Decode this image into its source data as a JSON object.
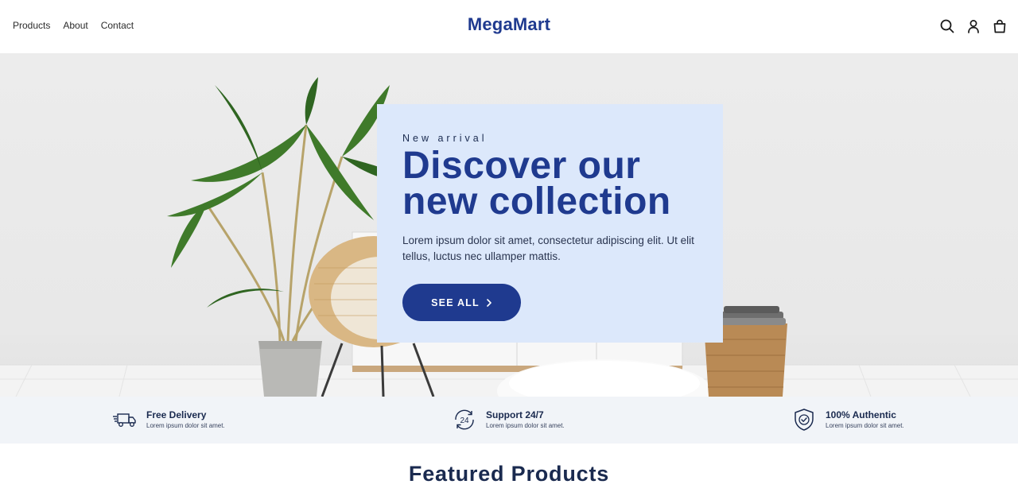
{
  "header": {
    "nav": [
      {
        "label": "Products"
      },
      {
        "label": "About"
      },
      {
        "label": "Contact"
      }
    ],
    "logo": "MegaMart",
    "icons": [
      "search-icon",
      "user-icon",
      "shopping-bag-icon"
    ]
  },
  "hero": {
    "eyebrow": "New arrival",
    "title_line1": "Discover our",
    "title_line2": "new collection",
    "description": "Lorem ipsum dolor sit amet, consectetur adipiscing elit. Ut elit tellus, luctus nec ullamper mattis.",
    "button_label": "SEE ALL",
    "button_icon": "chevron-right-icon"
  },
  "features": [
    {
      "icon": "delivery-truck-icon",
      "title": "Free Delivery",
      "subtitle": "Lorem ipsum dolor sit amet."
    },
    {
      "icon": "support-24-7-icon",
      "title": "Support 24/7",
      "subtitle": "Lorem ipsum dolor sit amet."
    },
    {
      "icon": "shield-check-icon",
      "title": "100% Authentic",
      "subtitle": "Lorem ipsum dolor sit amet."
    }
  ],
  "featured": {
    "title": "Featured Products"
  },
  "colors": {
    "brand": "#1f3a8f",
    "card_background": "#dce8fb",
    "strip_background": "#f1f4f8"
  }
}
